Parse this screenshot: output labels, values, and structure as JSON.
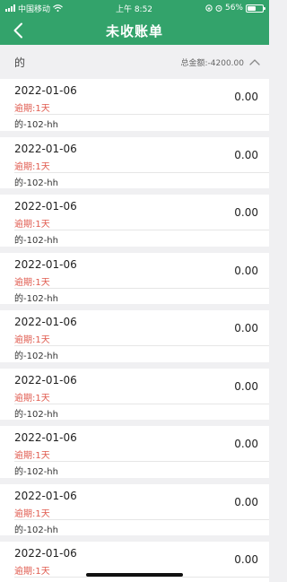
{
  "status_bar": {
    "carrier": "中国移动",
    "time": "上午 8:52",
    "battery": "56%",
    "battery_level": 0.56
  },
  "nav": {
    "title": "未收账单"
  },
  "summary": {
    "name": "的",
    "total_label": "总金额:",
    "total_value": "-4200.00"
  },
  "bills": [
    {
      "date": "2022-01-06",
      "amount": "0.00",
      "overdue_label": "逾期:",
      "overdue_value": "1天",
      "customer": "的-102-hh"
    },
    {
      "date": "2022-01-06",
      "amount": "0.00",
      "overdue_label": "逾期:",
      "overdue_value": "1天",
      "customer": "的-102-hh"
    },
    {
      "date": "2022-01-06",
      "amount": "0.00",
      "overdue_label": "逾期:",
      "overdue_value": "1天",
      "customer": "的-102-hh"
    },
    {
      "date": "2022-01-06",
      "amount": "0.00",
      "overdue_label": "逾期:",
      "overdue_value": "1天",
      "customer": "的-102-hh"
    },
    {
      "date": "2022-01-06",
      "amount": "0.00",
      "overdue_label": "逾期:",
      "overdue_value": "1天",
      "customer": "的-102-hh"
    },
    {
      "date": "2022-01-06",
      "amount": "0.00",
      "overdue_label": "逾期:",
      "overdue_value": "1天",
      "customer": "的-102-hh"
    },
    {
      "date": "2022-01-06",
      "amount": "0.00",
      "overdue_label": "逾期:",
      "overdue_value": "1天",
      "customer": "的-102-hh"
    },
    {
      "date": "2022-01-06",
      "amount": "0.00",
      "overdue_label": "逾期:",
      "overdue_value": "1天",
      "customer": "的-102-hh"
    },
    {
      "date": "2022-01-06",
      "amount": "0.00",
      "overdue_label": "逾期:",
      "overdue_value": "1天",
      "customer": "的-102-hh"
    }
  ],
  "colors": {
    "brand_green": "#33a36b",
    "overdue_red": "#e05a4e",
    "background": "#f0f0f2"
  },
  "icons": {
    "back": "chevron-left-icon",
    "summary_toggle": "chevron-up-icon",
    "signal": "cellular-signal-icon",
    "wifi": "wifi-icon",
    "alarm": "alarm-icon",
    "lock": "orientation-lock-icon",
    "battery": "battery-icon"
  }
}
